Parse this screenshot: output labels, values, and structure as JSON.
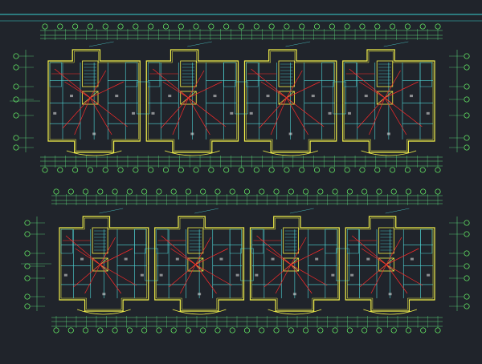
{
  "drawing": {
    "colors": {
      "background": "#20242b",
      "frame": "#39d1d1",
      "wall": "#f2f04a",
      "partition": "#4fd8d8",
      "wiring": "#ff2a2a",
      "dimension": "#5ee07e",
      "axis_bubble": "#6bff6b",
      "title": "#f2f04a",
      "scale": "#5ee07e",
      "room_label": "#e8e8e8"
    },
    "plans": [
      {
        "title": "",
        "scale": "",
        "bottom_dimensions": [
          "",
          "",
          "",
          "",
          "",
          "",
          "",
          "",
          "",
          ""
        ],
        "units": 4
      },
      {
        "title": "",
        "scale": "",
        "bottom_dimensions": [
          "",
          "",
          "",
          "",
          "",
          "",
          "",
          "",
          "",
          ""
        ],
        "units": 4
      }
    ]
  }
}
